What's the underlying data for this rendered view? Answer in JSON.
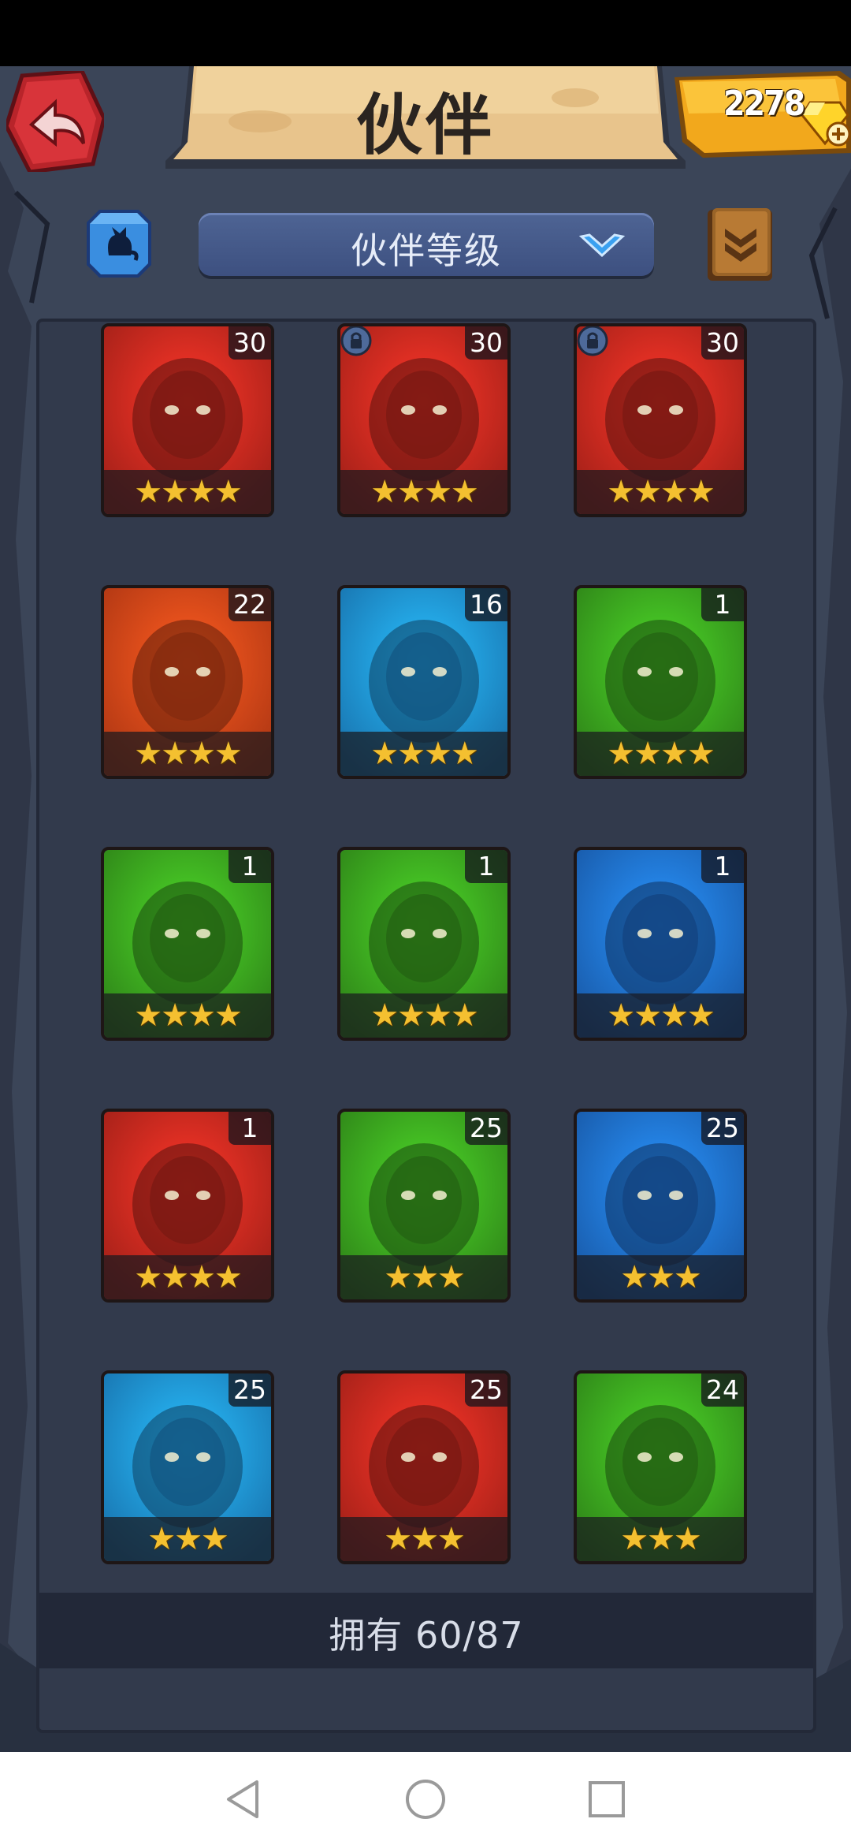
{
  "header": {
    "title": "伙伴",
    "gems": "2278"
  },
  "filter": {
    "sort_label": "伙伴等级"
  },
  "partners": [
    {
      "level": "30",
      "stars": 4,
      "bg": "#c8281e",
      "locked": false
    },
    {
      "level": "30",
      "stars": 4,
      "bg": "#c8281e",
      "locked": true
    },
    {
      "level": "30",
      "stars": 4,
      "bg": "#c8281e",
      "locked": true
    },
    {
      "level": "22",
      "stars": 4,
      "bg": "#d84418",
      "locked": false
    },
    {
      "level": "16",
      "stars": 4,
      "bg": "#1e8ed8",
      "locked": false
    },
    {
      "level": "1",
      "stars": 4,
      "bg": "#3aa21e",
      "locked": false
    },
    {
      "level": "1",
      "stars": 4,
      "bg": "#3aa21e",
      "locked": false
    },
    {
      "level": "1",
      "stars": 4,
      "bg": "#3aa21e",
      "locked": false
    },
    {
      "level": "1",
      "stars": 4,
      "bg": "#1e6ed0",
      "locked": false
    },
    {
      "level": "1",
      "stars": 4,
      "bg": "#c8281e",
      "locked": false
    },
    {
      "level": "25",
      "stars": 3,
      "bg": "#3aa21e",
      "locked": false
    },
    {
      "level": "25",
      "stars": 3,
      "bg": "#1e6ed0",
      "locked": false
    },
    {
      "level": "25",
      "stars": 3,
      "bg": "#1e8ed8",
      "locked": false
    },
    {
      "level": "25",
      "stars": 3,
      "bg": "#c8281e",
      "locked": false
    },
    {
      "level": "24",
      "stars": 3,
      "bg": "#3aa21e",
      "locked": false
    }
  ],
  "footer": {
    "owned_text": "拥有 60/87"
  },
  "colors": {
    "frame": "#3b4558",
    "panel": "#323a4c",
    "dropdown": "#4e6494",
    "star": "#f4c030",
    "gem_panel": "#f2a81c"
  },
  "icons": {
    "back": "back-arrow-icon",
    "gem": "gem-icon",
    "filter": "cat-filter-icon",
    "caret": "chevron-down-icon",
    "book": "book-icon",
    "lock": "lock-icon"
  }
}
